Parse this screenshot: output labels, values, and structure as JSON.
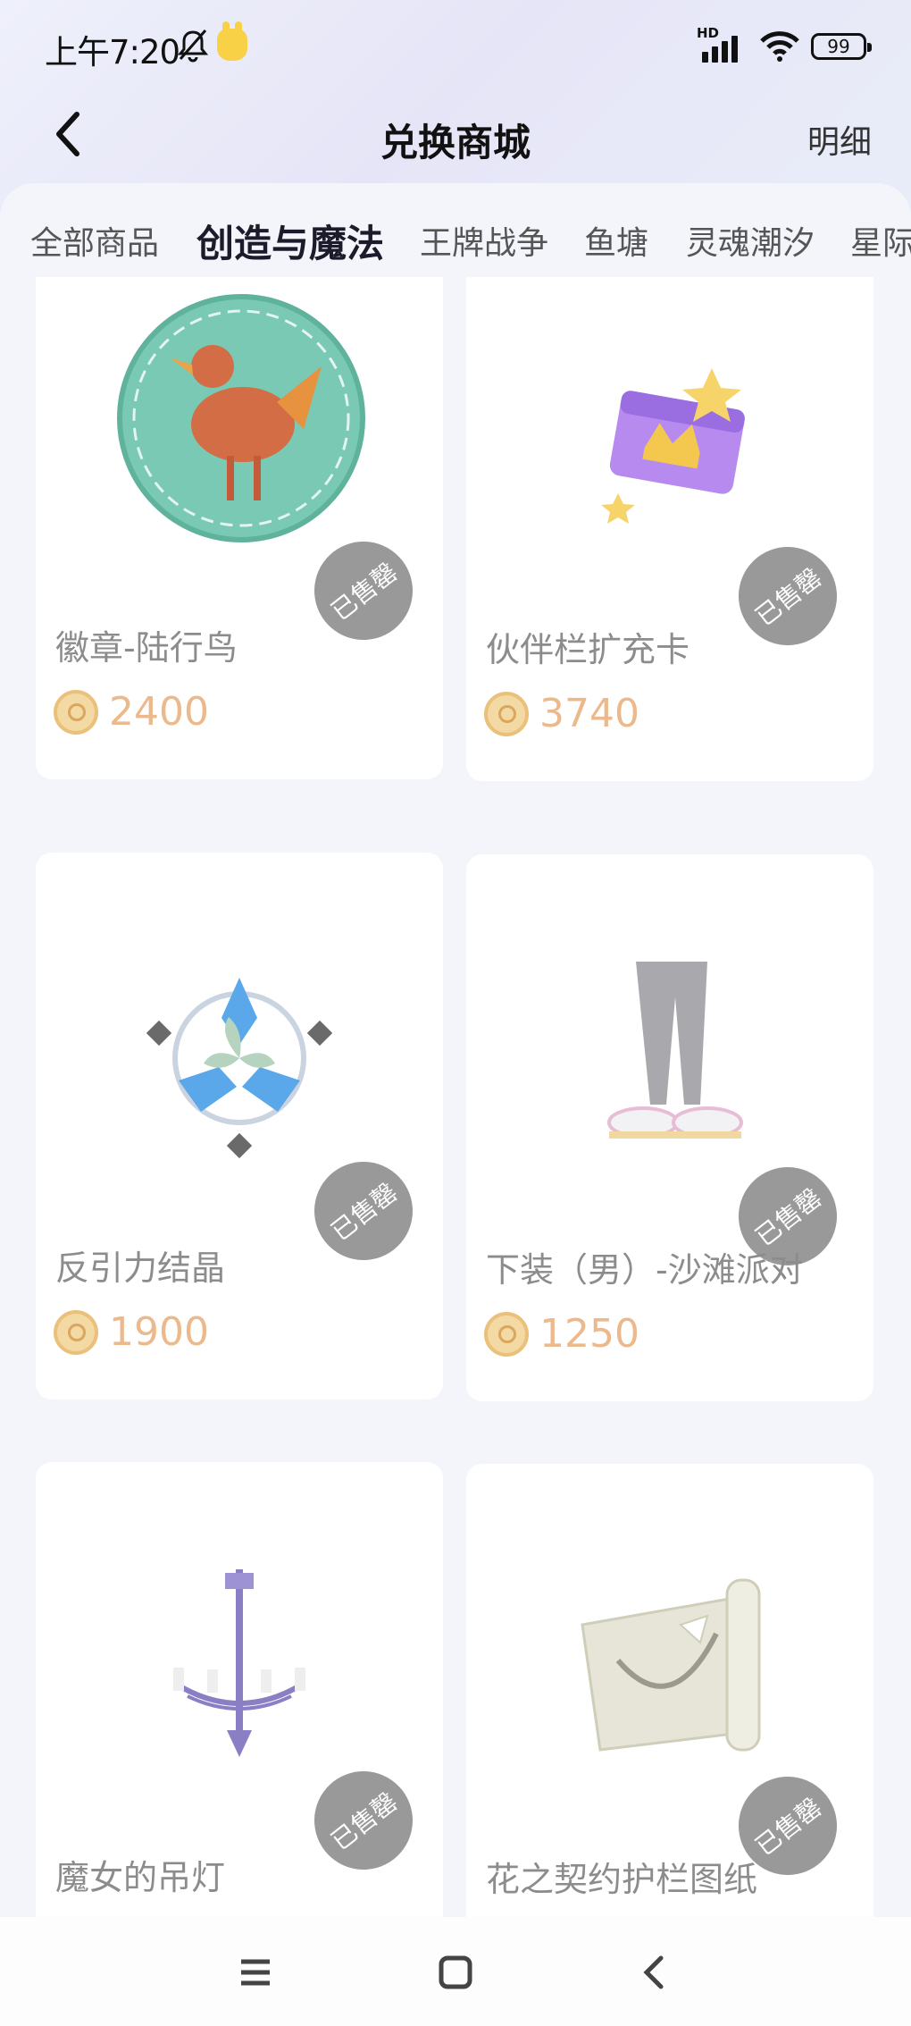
{
  "status_bar": {
    "time": "上午7:20",
    "network": "HD",
    "battery": "99"
  },
  "header": {
    "title": "兑换商城",
    "detail_label": "明细"
  },
  "tabs": [
    {
      "label": "全部商品"
    },
    {
      "label": "创造与魔法"
    },
    {
      "label": "王牌战争"
    },
    {
      "label": "鱼塘"
    },
    {
      "label": "灵魂潮汐"
    },
    {
      "label": "星际"
    }
  ],
  "active_tab": "创造与魔法",
  "sold_label": "已售罄",
  "products": [
    {
      "name": "徽章-陆行鸟",
      "price": "2400",
      "image": "badge-chocobo"
    },
    {
      "name": "伙伴栏扩充卡",
      "price": "3740",
      "image": "expansion-card"
    },
    {
      "name": "反引力结晶",
      "price": "1900",
      "image": "crystal"
    },
    {
      "name": "下装（男）-沙滩派对",
      "price": "1250",
      "image": "pants"
    },
    {
      "name": "魔女的吊灯",
      "image": "chandelier"
    },
    {
      "name": "花之契约护栏图纸",
      "image": "blueprint"
    }
  ],
  "colors": {
    "accent": "#7d6ee6",
    "price": "#ecb98d",
    "sold_badge": "#8e8e8e"
  }
}
